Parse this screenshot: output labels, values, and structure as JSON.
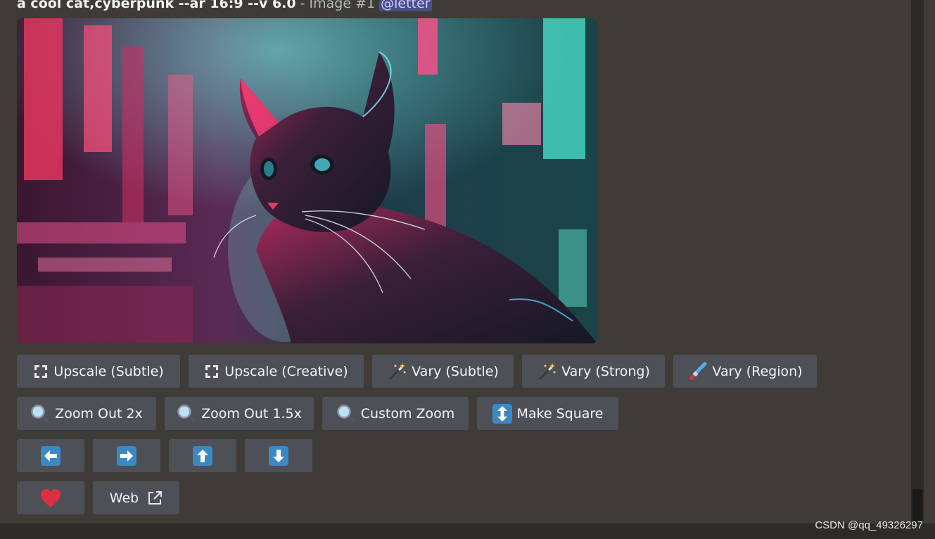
{
  "message": {
    "prompt": "a cool cat,cyberpunk --ar 16:9 --v 6.0",
    "separator": " - Image #1 ",
    "mention": "@letter"
  },
  "image": {
    "description_icon": "cyberpunk-cat-image"
  },
  "buttons": {
    "row1": [
      {
        "label": "Upscale (Subtle)",
        "icon": "expand-icon"
      },
      {
        "label": "Upscale (Creative)",
        "icon": "expand-icon"
      },
      {
        "label": "Vary (Subtle)",
        "icon": "magic-wand-icon"
      },
      {
        "label": "Vary (Strong)",
        "icon": "magic-wand-icon"
      },
      {
        "label": "Vary (Region)",
        "icon": "paintbrush-icon"
      }
    ],
    "row2": [
      {
        "label": "Zoom Out 2x",
        "icon": "magnifier-icon"
      },
      {
        "label": "Zoom Out 1.5x",
        "icon": "magnifier-icon"
      },
      {
        "label": "Custom Zoom",
        "icon": "magnifier-icon"
      },
      {
        "label": "Make Square",
        "icon": "up-down-arrow-icon"
      }
    ],
    "row3": [
      {
        "icon": "arrow-left-icon"
      },
      {
        "icon": "arrow-right-icon"
      },
      {
        "icon": "arrow-up-icon"
      },
      {
        "icon": "arrow-down-icon"
      }
    ],
    "row4": [
      {
        "icon": "heart-icon"
      },
      {
        "label": "Web",
        "icon": "external-link-icon"
      }
    ]
  },
  "colors": {
    "background": "#3f3b36",
    "button": "#4e5058",
    "mention_bg": "#5865f2",
    "arrow_blue": "#3b88c3",
    "heart": "#dd2e44"
  },
  "watermark": "CSDN @qq_49326297"
}
